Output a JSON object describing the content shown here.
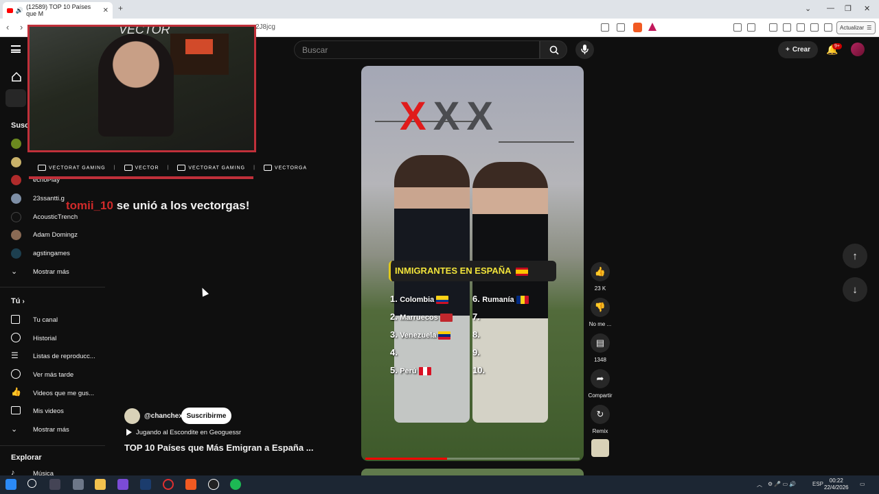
{
  "browser": {
    "tab_title": "(12589) TOP 10 Países que M",
    "url": "2J8jcg",
    "update_label": "Actualizar"
  },
  "header": {
    "search_placeholder": "Buscar",
    "create_label": "Crear",
    "notifications_badge": "9+"
  },
  "sidebar": {
    "subs_heading": "Susc",
    "channels": [
      "",
      "",
      "echoPlay",
      "23ssantti.g",
      "AcousticTrench",
      "Adam Domingz",
      "agstingames"
    ],
    "show_more_subs": "Mostrar más",
    "you_heading": "Tú",
    "you_items": [
      "Tu canal",
      "Historial",
      "Listas de reproducc...",
      "Ver más tarde",
      "Videos que me gus...",
      "Mis videos"
    ],
    "show_more_you": "Mostrar más",
    "explore_heading": "Explorar",
    "explore_items": [
      "Música"
    ]
  },
  "stream_overlay": {
    "logo_text": "VECTOR",
    "socials": [
      "VECTORAT GAMING",
      "VECTOR",
      "VECTORAT GAMING",
      "VECTORGA"
    ],
    "alert_user": "tomii_10",
    "alert_text": " se unió a los vectorgas!"
  },
  "short": {
    "header_marks": [
      "X",
      "X",
      "X"
    ],
    "banner": "INMIGRANTES EN ESPAÑA",
    "left_ranks": [
      {
        "n": "1.",
        "country": "Colombia"
      },
      {
        "n": "2.",
        "country": "Marruecos"
      },
      {
        "n": "3.",
        "country": "Venezuela"
      },
      {
        "n": "4.",
        "country": ""
      },
      {
        "n": "5.",
        "country": "Perú"
      }
    ],
    "right_ranks": [
      {
        "n": "6.",
        "country": "Rumanía"
      },
      {
        "n": "7.",
        "country": ""
      },
      {
        "n": "8.",
        "country": ""
      },
      {
        "n": "9.",
        "country": ""
      },
      {
        "n": "10.",
        "country": ""
      }
    ],
    "progress_percent": 38,
    "channel": "@chanchex",
    "subscribe_label": "Suscribirme",
    "music": "Jugando al Escondite en Geoguessr",
    "title": "TOP 10 Países que Más Emigran a España ..."
  },
  "actions": {
    "likes": "23 K",
    "dislike_label": "No me ...",
    "comments": "1348",
    "share_label": "Compartir",
    "remix_label": "Remix"
  },
  "taskbar": {
    "lang": "ESP",
    "time": "00:22",
    "date": "22/4/2026"
  },
  "colors": {
    "accent_red": "#ff0000",
    "overlay_red": "#c0303a",
    "banner_yellow": "#f2e43a"
  }
}
